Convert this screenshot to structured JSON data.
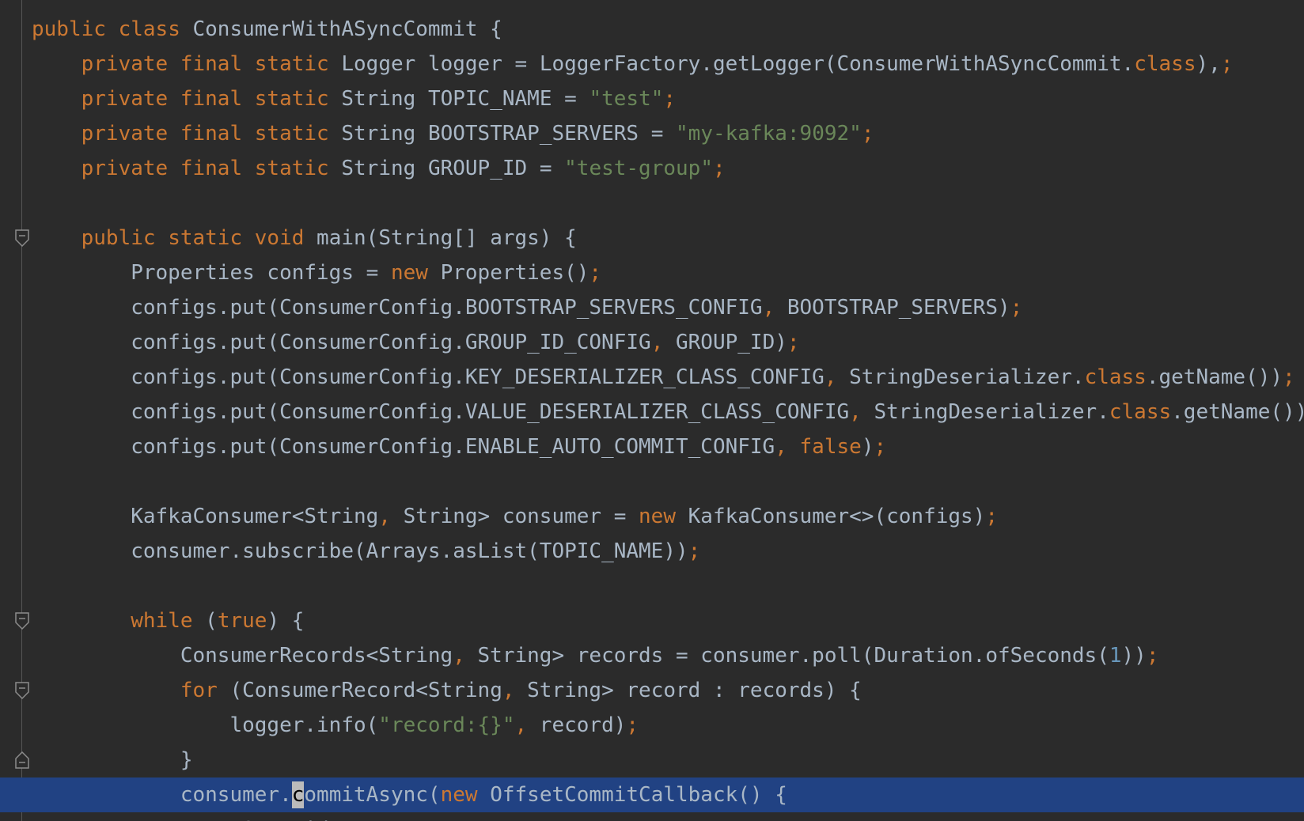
{
  "editor": {
    "theme_colors": {
      "background": "#2b2b2b",
      "text": "#a9b7c6",
      "keyword": "#cc7832",
      "string": "#6a8759",
      "number": "#6897bb",
      "selection": "#214283"
    },
    "fold_markers": [
      {
        "line": 7,
        "type": "open"
      },
      {
        "line": 18,
        "type": "open"
      },
      {
        "line": 20,
        "type": "open"
      },
      {
        "line": 22,
        "type": "close"
      },
      {
        "line": 23,
        "type": "open"
      }
    ],
    "lines": [
      [
        [
          "kw",
          "public "
        ],
        [
          "kw",
          "class "
        ],
        [
          "",
          "ConsumerWithASyncCommit {"
        ]
      ],
      [
        [
          "",
          "    "
        ],
        [
          "kw",
          "private final static "
        ],
        [
          "",
          "Logger logger = LoggerFactory."
        ],
        [
          "",
          "getLogger"
        ],
        [
          "",
          "(ConsumerWithASyncCommit."
        ],
        [
          "kw",
          "class"
        ],
        [
          "",
          "),"
        ],
        [
          "kw",
          ";"
        ]
      ],
      [
        [
          "",
          "    "
        ],
        [
          "kw",
          "private final static "
        ],
        [
          "",
          "String "
        ],
        [
          "",
          "TOPIC_NAME"
        ],
        [
          "",
          ""
        ],
        [
          "",
          " = "
        ],
        [
          "str",
          "\"test\""
        ],
        [
          "kw",
          ";"
        ]
      ],
      [
        [
          "",
          "    "
        ],
        [
          "kw",
          "private final static "
        ],
        [
          "",
          "String "
        ],
        [
          "",
          "BOOTSTRAP_SERVERS"
        ],
        [
          "",
          " = "
        ],
        [
          "str",
          "\"my-kafka:9092\""
        ],
        [
          "kw",
          ";"
        ]
      ],
      [
        [
          "",
          "    "
        ],
        [
          "kw",
          "private final static "
        ],
        [
          "",
          "String "
        ],
        [
          "",
          "GROUP_ID"
        ],
        [
          "",
          " = "
        ],
        [
          "str",
          "\"test-group\""
        ],
        [
          "kw",
          ";"
        ]
      ],
      [
        [
          "",
          ""
        ]
      ],
      [
        [
          "",
          "    "
        ],
        [
          "kw",
          "public static void "
        ],
        [
          "",
          "main(String[] args) {"
        ]
      ],
      [
        [
          "",
          "        Properties configs = "
        ],
        [
          "kw",
          "new "
        ],
        [
          "",
          "Properties()"
        ],
        [
          "kw",
          ";"
        ]
      ],
      [
        [
          "",
          "        configs.put(ConsumerConfig."
        ],
        [
          "",
          "BOOTSTRAP_SERVERS_CONFIG"
        ],
        [
          "kw",
          ", "
        ],
        [
          "",
          "BOOTSTRAP_SERVERS"
        ],
        [
          "",
          ")"
        ],
        [
          "kw",
          ";"
        ]
      ],
      [
        [
          "",
          "        configs.put(ConsumerConfig."
        ],
        [
          "",
          "GROUP_ID_CONFIG"
        ],
        [
          "kw",
          ", "
        ],
        [
          "",
          "GROUP_ID"
        ],
        [
          "",
          ")"
        ],
        [
          "kw",
          ";"
        ]
      ],
      [
        [
          "",
          "        configs.put(ConsumerConfig."
        ],
        [
          "",
          "KEY_DESERIALIZER_CLASS_CONFIG"
        ],
        [
          "kw",
          ", "
        ],
        [
          "",
          "StringDeserializer."
        ],
        [
          "kw",
          "class"
        ],
        [
          "",
          ".getName())"
        ],
        [
          "kw",
          ";"
        ]
      ],
      [
        [
          "",
          "        configs.put(ConsumerConfig."
        ],
        [
          "",
          "VALUE_DESERIALIZER_CLASS_CONFIG"
        ],
        [
          "kw",
          ", "
        ],
        [
          "",
          "StringDeserializer."
        ],
        [
          "kw",
          "class"
        ],
        [
          "",
          ".getName())"
        ]
      ],
      [
        [
          "",
          "        configs.put(ConsumerConfig."
        ],
        [
          "",
          "ENABLE_AUTO_COMMIT_CONFIG"
        ],
        [
          "kw",
          ", "
        ],
        [
          "kw",
          "false"
        ],
        [
          "",
          ")"
        ],
        [
          "kw",
          ";"
        ]
      ],
      [
        [
          "",
          ""
        ]
      ],
      [
        [
          "",
          "        KafkaConsumer<String"
        ],
        [
          "kw",
          ", "
        ],
        [
          "",
          "String> consumer = "
        ],
        [
          "kw",
          "new "
        ],
        [
          "",
          "KafkaConsumer<>(configs)"
        ],
        [
          "kw",
          ";"
        ]
      ],
      [
        [
          "",
          "        consumer.subscribe(Arrays."
        ],
        [
          "",
          "asList"
        ],
        [
          "",
          "("
        ],
        [
          "",
          "TOPIC_NAME"
        ],
        [
          "",
          "))"
        ],
        [
          "kw",
          ";"
        ]
      ],
      [
        [
          "",
          ""
        ]
      ],
      [
        [
          "",
          "        "
        ],
        [
          "kw",
          "while "
        ],
        [
          "",
          "("
        ],
        [
          "kw",
          "true"
        ],
        [
          "",
          ") {"
        ]
      ],
      [
        [
          "",
          "            ConsumerRecords<String"
        ],
        [
          "kw",
          ", "
        ],
        [
          "",
          "String> records = consumer.poll(Duration."
        ],
        [
          "",
          "ofSeconds"
        ],
        [
          "",
          "("
        ],
        [
          "num",
          "1"
        ],
        [
          "",
          "))"
        ],
        [
          "kw",
          ";"
        ]
      ],
      [
        [
          "",
          "            "
        ],
        [
          "kw",
          "for "
        ],
        [
          "",
          "(ConsumerRecord<String"
        ],
        [
          "kw",
          ", "
        ],
        [
          "",
          "String> record : records) {"
        ]
      ],
      [
        [
          "",
          "                "
        ],
        [
          "",
          "logger"
        ],
        [
          "",
          ".info("
        ],
        [
          "str",
          "\"record:{}\""
        ],
        [
          "kw",
          ", "
        ],
        [
          "",
          "record)"
        ],
        [
          "kw",
          ";"
        ]
      ],
      [
        [
          "",
          "            }"
        ]
      ],
      [
        [
          "",
          "            consumer."
        ],
        [
          "cursor",
          "c"
        ],
        [
          "",
          "ommitAsync("
        ],
        [
          "kw",
          "new "
        ],
        [
          "",
          "OffsetCommitCallback() {"
        ]
      ],
      [
        [
          "",
          "                "
        ],
        [
          "",
          "@Override"
        ]
      ]
    ],
    "current_line": 23
  }
}
